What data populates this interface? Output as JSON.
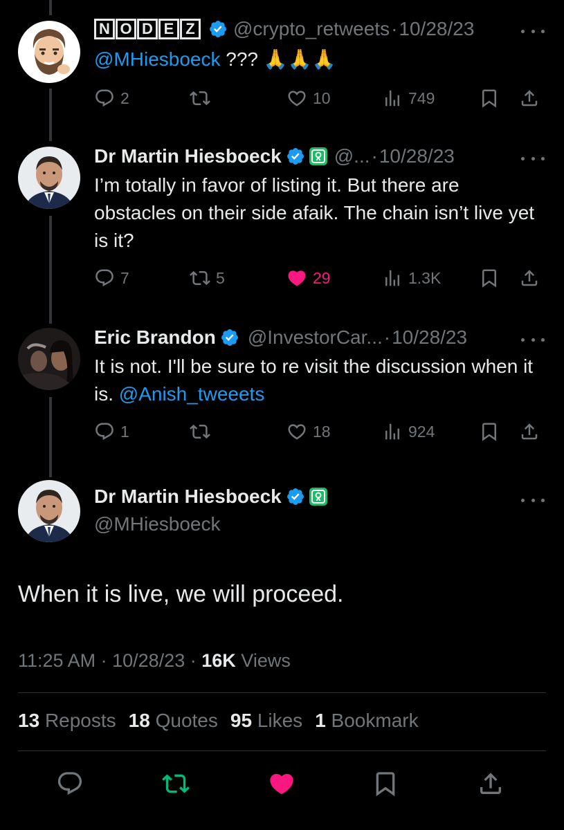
{
  "replies": [
    {
      "name_boxes": [
        "N",
        "O",
        "D",
        "E",
        "Z"
      ],
      "handle": "@crypto_retweets",
      "separator": "·",
      "date": "10/28/23",
      "mention": "@MHiesboeck",
      "text": " ??? 🙏🙏🙏",
      "counts": {
        "reply": "2",
        "repost": "",
        "like": "10",
        "views": "749"
      }
    },
    {
      "name": "Dr Martin Hiesboeck",
      "handle": "@...",
      "separator": "·",
      "date": "10/28/23",
      "text": "I’m totally in favor of listing it. But there are obstacles on their side afaik. The chain isn’t live yet is it?",
      "counts": {
        "reply": "7",
        "repost": "5",
        "like": "29",
        "views": "1.3K"
      }
    },
    {
      "name": "Eric Brandon",
      "handle": "@InvestorCar...",
      "separator": "·",
      "date": "10/28/23",
      "text": "It is not. I'll be sure to re visit the discussion when it is. ",
      "mention": "@Anish_tweeets",
      "counts": {
        "reply": "1",
        "repost": "",
        "like": "18",
        "views": "924"
      }
    }
  ],
  "main_tweet": {
    "name": "Dr Martin Hiesboeck",
    "handle": "@MHiesboeck",
    "text": "When it is live, we will proceed.",
    "time": "11:25 AM",
    "separator": "·",
    "date": "10/28/23",
    "views_count": "16K",
    "views_label": "Views"
  },
  "stats": {
    "reposts_count": "13",
    "reposts_label": "Reposts",
    "quotes_count": "18",
    "quotes_label": "Quotes",
    "likes_count": "95",
    "likes_label": "Likes",
    "bookmarks_count": "1",
    "bookmarks_label": "Bookmark"
  },
  "icons": {
    "reply": "reply-icon",
    "repost": "repost-icon",
    "like": "heart-icon",
    "views": "views-icon",
    "bookmark": "bookmark-icon",
    "share": "share-icon",
    "verified": "verified-badge-icon",
    "affiliate": "affiliate-badge-icon",
    "more": "more-icon"
  },
  "colors": {
    "background": "#000000",
    "text": "#e7e9ea",
    "muted": "#71767b",
    "link": "#1d9bf0",
    "like": "#f91880",
    "repost_active": "#00ba7c",
    "verified": "#1d9bf0",
    "affiliate_badge": "#1fba68"
  }
}
